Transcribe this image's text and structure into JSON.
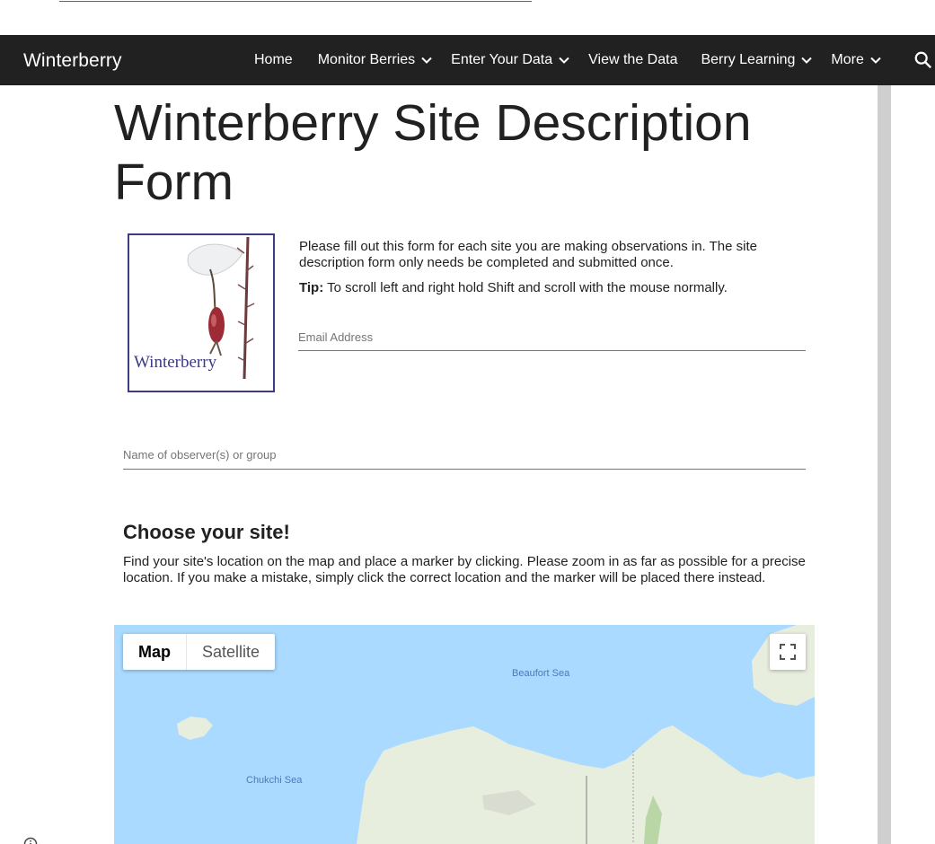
{
  "site": {
    "brand": "Winterberry"
  },
  "nav": {
    "items": [
      {
        "label": "Home"
      },
      {
        "label": "Monitor Berries"
      },
      {
        "label": "Enter Your Data"
      },
      {
        "label": "View the Data"
      },
      {
        "label": "Berry Learning"
      },
      {
        "label": "More"
      }
    ]
  },
  "page": {
    "title": "Winterberry Site Description Form",
    "logo_text": "Winterberry",
    "intro": "Please fill out this form for each site you are making observations in. The site description form only needs be completed and submitted once.",
    "tip_label": "Tip:",
    "tip_text": " To scroll left and right hold Shift and scroll with the mouse normally."
  },
  "form": {
    "email_placeholder": "Email Address",
    "email_value": "",
    "name_placeholder": "Name of observer(s) or group",
    "name_value": ""
  },
  "site_section": {
    "heading": "Choose your site!",
    "body": "Find your site's location on the map and place a marker by clicking. Please zoom in as far as possible for a precise location. If you make a mistake, simply click the correct location and the marker will be placed there instead."
  },
  "map": {
    "type_buttons": [
      "Map",
      "Satellite"
    ],
    "selected_type": "Map",
    "labels": {
      "beaufort": "Beaufort Sea",
      "chukchi": "Chukchi Sea"
    },
    "colors": {
      "water": "#aadaff",
      "land": "#e8eede"
    }
  },
  "icons": {
    "search": "search-icon",
    "chevron": "chevron-down-icon",
    "fullscreen": "fullscreen-icon",
    "info": "info-icon"
  }
}
